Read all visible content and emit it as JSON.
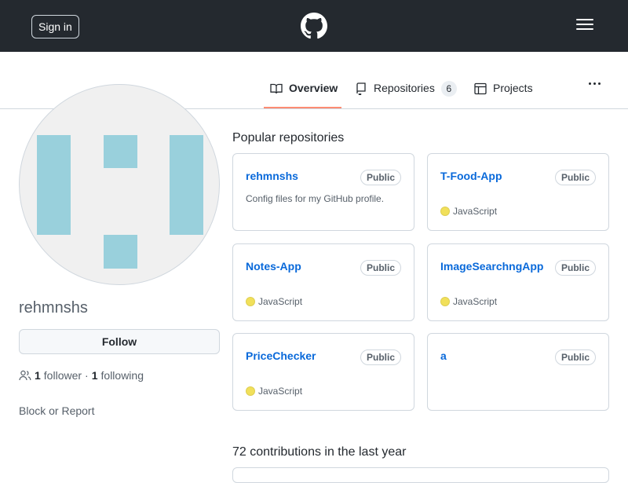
{
  "header": {
    "sign_in_label": "Sign in",
    "logo_icon": "github-mark-icon",
    "menu_icon": "hamburger-menu-icon"
  },
  "tabs": [
    {
      "label": "Overview",
      "icon": "book-icon",
      "selected": true
    },
    {
      "label": "Repositories",
      "icon": "repo-icon",
      "count": "6"
    },
    {
      "label": "Projects",
      "icon": "table-icon"
    }
  ],
  "more_icon": "kebab-horizontal-icon",
  "profile": {
    "username": "rehmnshs",
    "follow_label": "Follow",
    "followers_count": "1",
    "followers_label": "follower",
    "following_count": "1",
    "following_label": "following",
    "separator": "·",
    "block_report_label": "Block or Report"
  },
  "popular": {
    "title": "Popular repositories",
    "repos": [
      {
        "name": "rehmnshs",
        "visibility": "Public",
        "description": "Config files for my GitHub profile.",
        "language": ""
      },
      {
        "name": "T-Food-App",
        "visibility": "Public",
        "description": "",
        "language": "JavaScript"
      },
      {
        "name": "Notes-App",
        "visibility": "Public",
        "description": "",
        "language": "JavaScript"
      },
      {
        "name": "ImageSearchngApp",
        "visibility": "Public",
        "description": "",
        "language": "JavaScript"
      },
      {
        "name": "PriceChecker",
        "visibility": "Public",
        "description": "",
        "language": "JavaScript"
      },
      {
        "name": "a",
        "visibility": "Public",
        "description": "",
        "language": ""
      }
    ]
  },
  "colors": {
    "header_bg": "#24292f",
    "link": "#0969da",
    "tab_underline": "#fd8c73",
    "javascript": "#f1e05a",
    "avatar_blocks": "#99d0dc"
  },
  "contributions": {
    "title": "72 contributions in the last year"
  }
}
